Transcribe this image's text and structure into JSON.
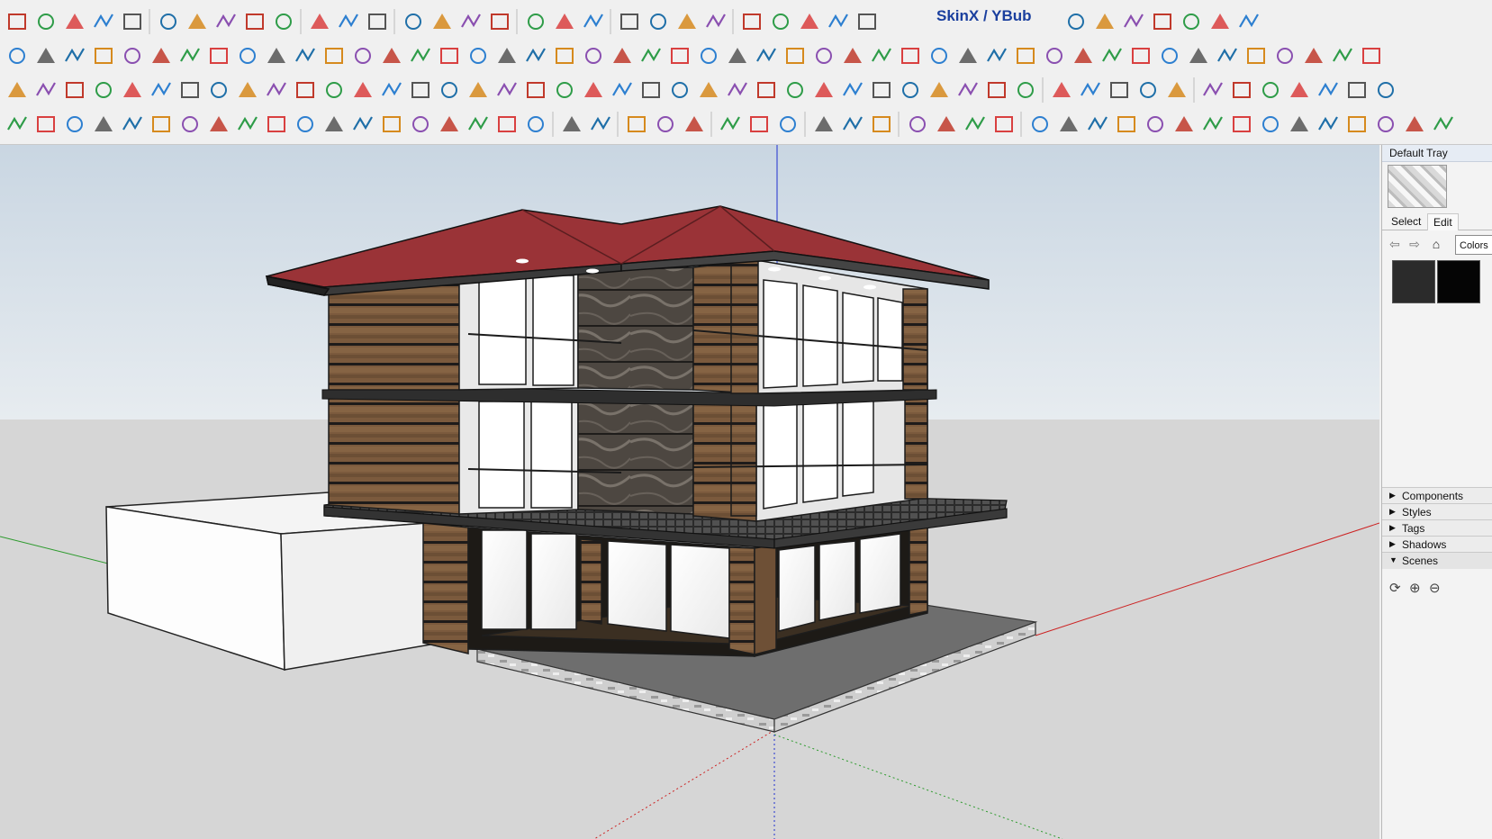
{
  "toolbar": {
    "extension_label": "SkinX / YBub"
  },
  "tray": {
    "title": "Default Tray",
    "tabs": [
      "Select",
      "Edit"
    ],
    "library_value": "Colors",
    "material_swatches": [
      {
        "name": "dark-gray",
        "color": "#2b2b2b"
      },
      {
        "name": "black",
        "color": "#050505"
      }
    ],
    "panels": [
      {
        "label": "Components",
        "expanded": false
      },
      {
        "label": "Styles",
        "expanded": false
      },
      {
        "label": "Tags",
        "expanded": false
      },
      {
        "label": "Shadows",
        "expanded": false
      },
      {
        "label": "Scenes",
        "expanded": true
      }
    ]
  },
  "icons": {
    "scene_tools": [
      "refresh-icon",
      "add-scene-icon",
      "remove-scene-icon"
    ],
    "nav": [
      "back-arrow-icon",
      "forward-arrow-icon",
      "home-icon"
    ]
  },
  "colors": {
    "sky": "#d4dee8",
    "ground": "#d6d6d6",
    "axis_red": "#cc2222",
    "axis_green": "#2c9a2c",
    "axis_blue": "#1f2fd0",
    "roof": "#9a3337",
    "wood": "#7a5a3c",
    "marble": "#5a534c"
  }
}
